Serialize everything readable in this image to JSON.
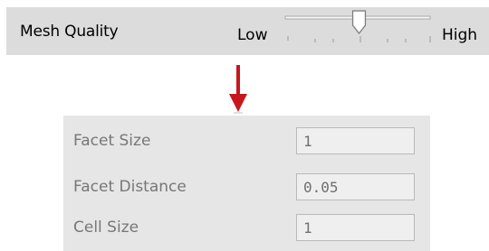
{
  "mesh_quality": {
    "label": "Mesh Quality",
    "low_label": "Low",
    "high_label": "High",
    "slider_value_fraction": 0.5
  },
  "parameters": [
    {
      "label": "Facet Size",
      "value": "1"
    },
    {
      "label": "Facet Distance",
      "value": "0.05"
    },
    {
      "label": "Cell Size",
      "value": "1"
    }
  ],
  "colors": {
    "arrow": "#c8161d",
    "bar_background": "#dcdcdc",
    "panel_background": "#e6e6e6"
  },
  "icons": {
    "arrow": "arrow-down-icon",
    "slider_thumb": "slider-thumb-icon"
  }
}
